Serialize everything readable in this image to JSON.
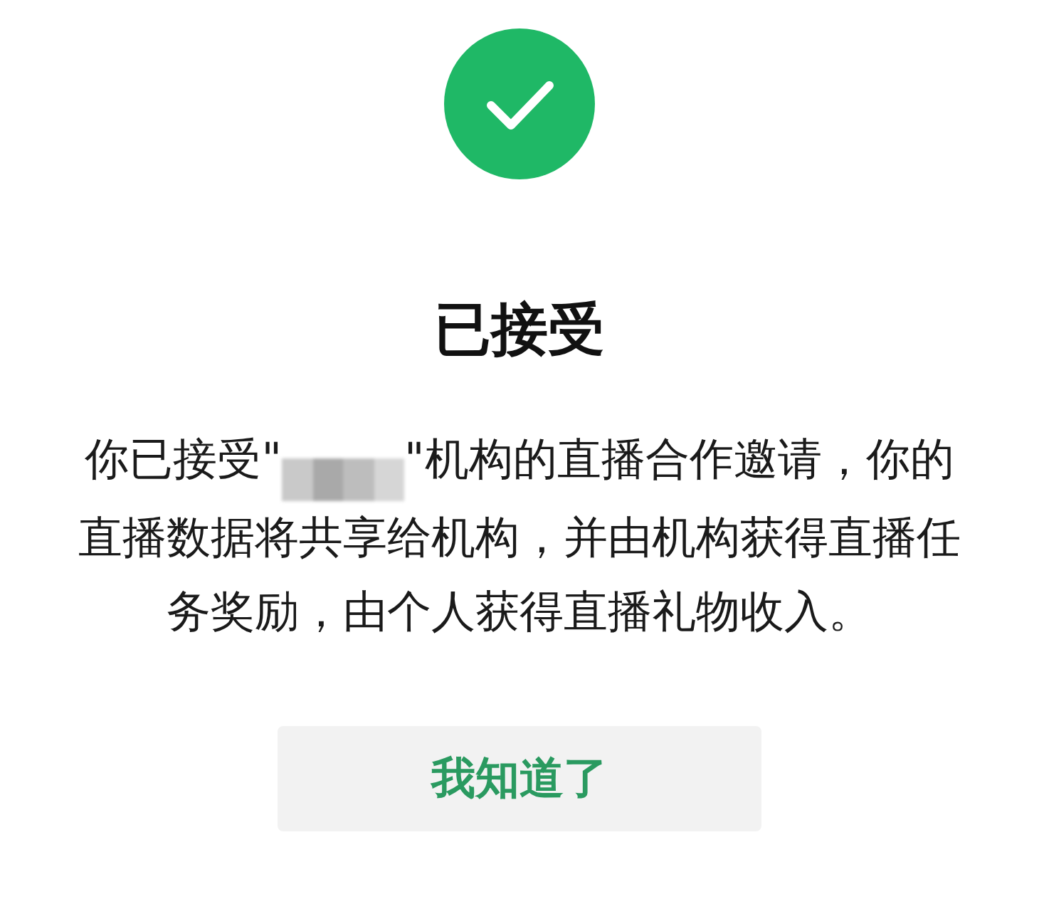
{
  "status_icon": {
    "kind": "success"
  },
  "title": "已接受",
  "message": {
    "before": "你已接受\"",
    "redacted": true,
    "after": "\"机构的直播合作邀请，你的直播数据将共享给机构，并由机构获得直播任务奖励，由个人获得直播礼物收入。"
  },
  "button": {
    "label": "我知道了"
  }
}
